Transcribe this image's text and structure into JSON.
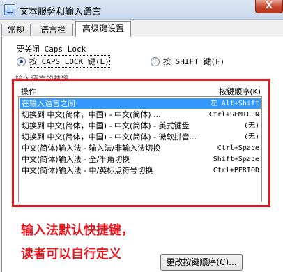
{
  "window": {
    "title": "文本服务和输入语言",
    "close_label": "X"
  },
  "tabs": [
    {
      "label": "常规"
    },
    {
      "label": "语言栏"
    },
    {
      "label": "高级键设置"
    }
  ],
  "caps_lock": {
    "group_label": "要关闭 Caps Lock",
    "option_caps": "按 CAPS LOCK 键(L)",
    "option_shift": "按 SHIFT 键(F)",
    "selected": "caps"
  },
  "hotkeys": {
    "section_label": "输入语言的热键",
    "col_action": "操作",
    "col_order": "按键顺序(K)",
    "rows": [
      {
        "action": "在输入语言之间",
        "keys": "左 Alt+Shift",
        "selected": true
      },
      {
        "action": "切换到 中文(简体，中国) - 中文(简体) ...",
        "keys": "Ctrl+SEMICLN"
      },
      {
        "action": "切换到 中文(简体，中国) - 中文(简体) - 美式键盘",
        "keys": "(无)"
      },
      {
        "action": "切换到 中文(简体，中国) - 中文(简体) - 微软拼音...",
        "keys": "(无)"
      },
      {
        "action": "中文(简体)输入法 - 输入法/非输入法切换",
        "keys": "Ctrl+Space"
      },
      {
        "action": "中文(简体)输入法 - 全/半角切换",
        "keys": "Shift+Space"
      },
      {
        "action": "中文(简体)输入法 - 中/英标点符号切换",
        "keys": "Ctrl+PERIOD"
      }
    ]
  },
  "annotation": {
    "line1": "输入法默认快捷键，",
    "line2": "读者可以自行定义",
    "color": "#e8141c"
  },
  "buttons": {
    "change_order": "更改按键顺序(C)..."
  },
  "colors": {
    "selection": "#3399ff",
    "highlight_box": "#e8141c"
  }
}
